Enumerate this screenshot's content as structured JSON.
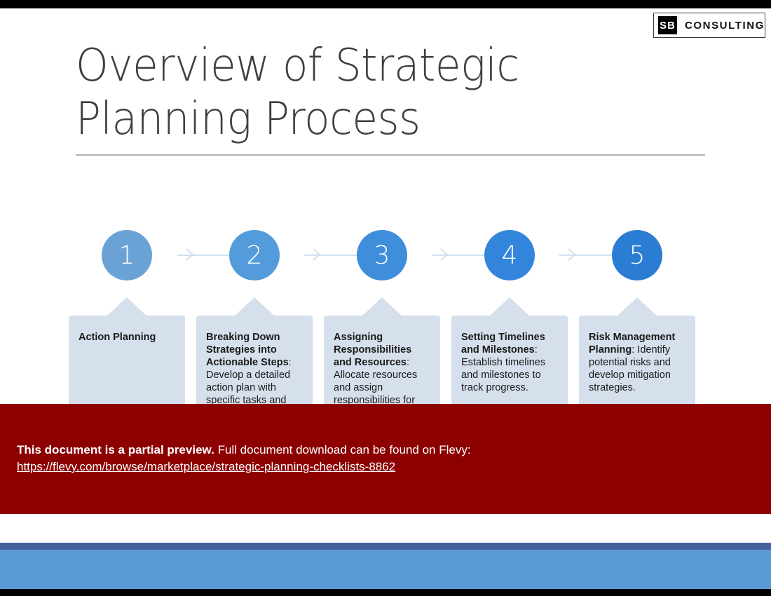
{
  "slide": {
    "title": "Overview of Strategic Planning Process",
    "accent_blue": "#5B9BD5",
    "box_fill": "#D6DFEC",
    "banner_red": "#8C0000"
  },
  "logo": {
    "mark": "SB",
    "word": "CONSULTING"
  },
  "process": {
    "steps": [
      {
        "number": "1",
        "circle_color": "#6AA2D6",
        "heading": "Action Planning",
        "body": ""
      },
      {
        "number": "2",
        "circle_color": "#539BDA",
        "heading": "Breaking Down Strategies into Actionable Steps",
        "body": ": Develop a detailed action plan with specific tasks and"
      },
      {
        "number": "3",
        "circle_color": "#3E8EDB",
        "heading": "Assigning Responsibilities and Resources",
        "body": ": Allocate resources and assign responsibilities for"
      },
      {
        "number": "4",
        "circle_color": "#3385DC",
        "heading": "Setting Timelines and Milestones",
        "body": ": Establish timelines and milestones to track progress."
      },
      {
        "number": "5",
        "circle_color": "#2B7CD3",
        "heading": "Risk Management Planning",
        "body": ": Identify potential risks and develop mitigation strategies."
      }
    ]
  },
  "preview_banner": {
    "bold_text": "This document is a partial preview.",
    "rest_text": " Full document download can be found on Flevy:",
    "url": "https://flevy.com/browse/marketplace/strategic-planning-checklists-8862"
  }
}
